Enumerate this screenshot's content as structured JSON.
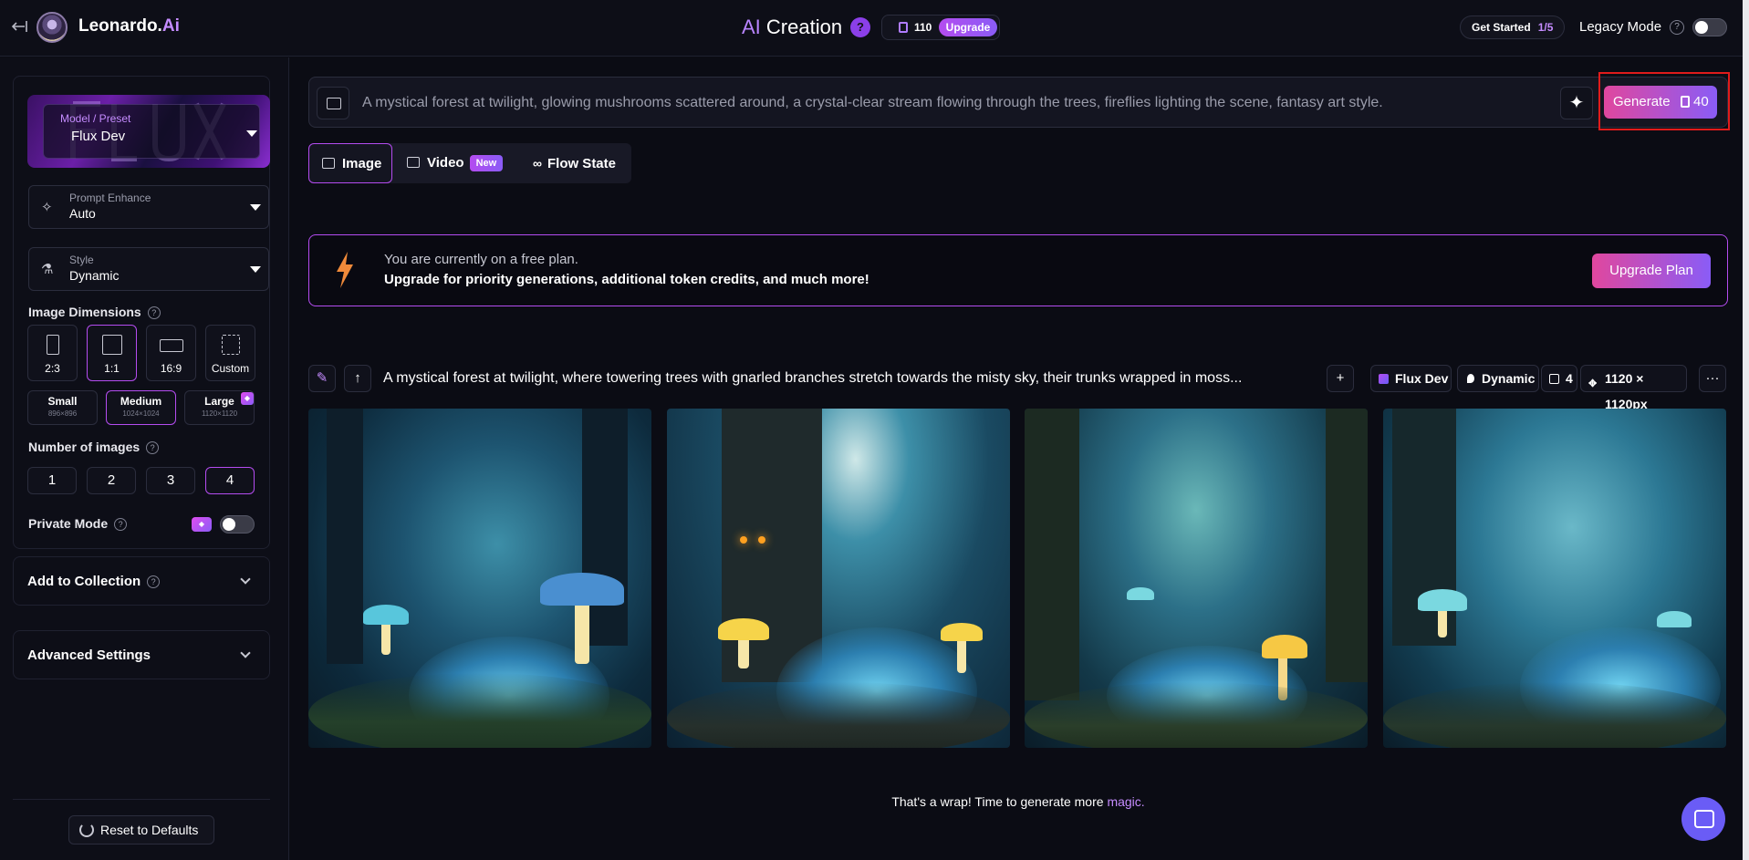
{
  "header": {
    "brand_name": "Leonardo.",
    "brand_ai": "Ai",
    "title_ai": "AI",
    "title_rest": " Creation",
    "help_glyph": "?",
    "token_count": "110",
    "upgrade_label": "Upgrade",
    "get_started_label": "Get Started",
    "get_started_progress": "1/5",
    "legacy_mode_label": "Legacy Mode",
    "legacy_mode_on": false
  },
  "sidebar": {
    "model_preset_label": "Model / Preset",
    "model_preset_value": "Flux Dev",
    "prompt_enhance_label": "Prompt Enhance",
    "prompt_enhance_value": "Auto",
    "style_label": "Style",
    "style_value": "Dynamic",
    "image_dimensions_label": "Image Dimensions",
    "aspect_ratios": [
      "2:3",
      "1:1",
      "16:9",
      "Custom"
    ],
    "aspect_ratio_selected": "1:1",
    "sizes": [
      {
        "name": "Small",
        "px": "896×896"
      },
      {
        "name": "Medium",
        "px": "1024×1024"
      },
      {
        "name": "Large",
        "px": "1120×1120"
      }
    ],
    "size_selected": "Medium",
    "number_of_images_label": "Number of images",
    "number_options": [
      "1",
      "2",
      "3",
      "4"
    ],
    "number_selected": "4",
    "private_mode_label": "Private Mode",
    "private_mode_on": false,
    "add_to_collection_label": "Add to Collection",
    "advanced_settings_label": "Advanced Settings",
    "reset_label": "Reset to Defaults"
  },
  "prompt": {
    "text": "A mystical forest at twilight, glowing mushrooms scattered around, a crystal-clear stream flowing through the trees, fireflies lighting the scene, fantasy art style.",
    "generate_label": "Generate",
    "generate_cost": "40"
  },
  "tabs": [
    {
      "label": "Image",
      "active": true
    },
    {
      "label": "Video",
      "badge": "New"
    },
    {
      "label": "Flow State"
    }
  ],
  "banner": {
    "line1": "You are currently on a free plan.",
    "line2": "Upgrade for priority generations, additional token credits, and much more!",
    "button_label": "Upgrade Plan"
  },
  "generation": {
    "prompt": "A mystical forest at twilight, where towering trees with gnarled branches stretch towards the misty sky, their trunks wrapped in moss...",
    "model_chip": "Flux Dev",
    "style_chip": "Dynamic",
    "count_chip": "4",
    "size_chip": "1120 × 1120px",
    "images": [
      "forest-image-1",
      "forest-image-2",
      "forest-image-3",
      "forest-image-4"
    ]
  },
  "footer": {
    "wrap_text": "That's a wrap! Time to generate more ",
    "wrap_link": "magic."
  },
  "colors": {
    "accent_purple": "#b44cf0",
    "gradient_pink": "#e0479e",
    "gradient_violet": "#8a5cf6",
    "highlight_red": "#e01b1b",
    "background": "#0b0c14"
  }
}
